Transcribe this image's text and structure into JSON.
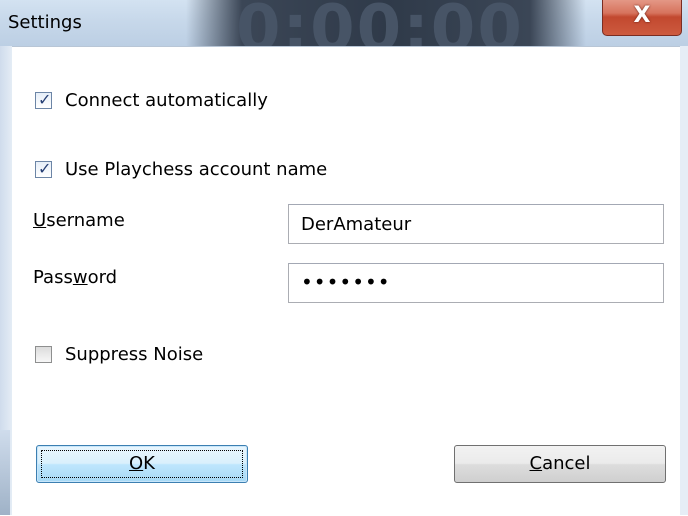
{
  "window": {
    "title": "Settings",
    "timer_overlay": "0:00:00",
    "close_glyph": "X"
  },
  "options": {
    "connect_automatically": {
      "label": "Connect automatically",
      "checked": true
    },
    "use_playchess_account": {
      "label": "Use Playchess account name",
      "checked": true
    },
    "suppress_noise": {
      "label": "Suppress Noise",
      "checked": false
    }
  },
  "fields": {
    "username": {
      "label_access": "U",
      "label_rest": "sername",
      "value": "DerAmateur"
    },
    "password": {
      "label_before": "Pass",
      "label_access": "w",
      "label_after": "ord",
      "value": "•••••••"
    }
  },
  "buttons": {
    "ok": {
      "access": "O",
      "rest": "K"
    },
    "cancel": {
      "access": "C",
      "rest": "ancel"
    }
  },
  "colors": {
    "title_bar": "#c7d8ea",
    "close_button": "#c2482f",
    "default_button": "#bee6fd",
    "checkmark": "#263f74"
  },
  "icons": {
    "checkmark": "check-icon",
    "close": "close-icon"
  }
}
